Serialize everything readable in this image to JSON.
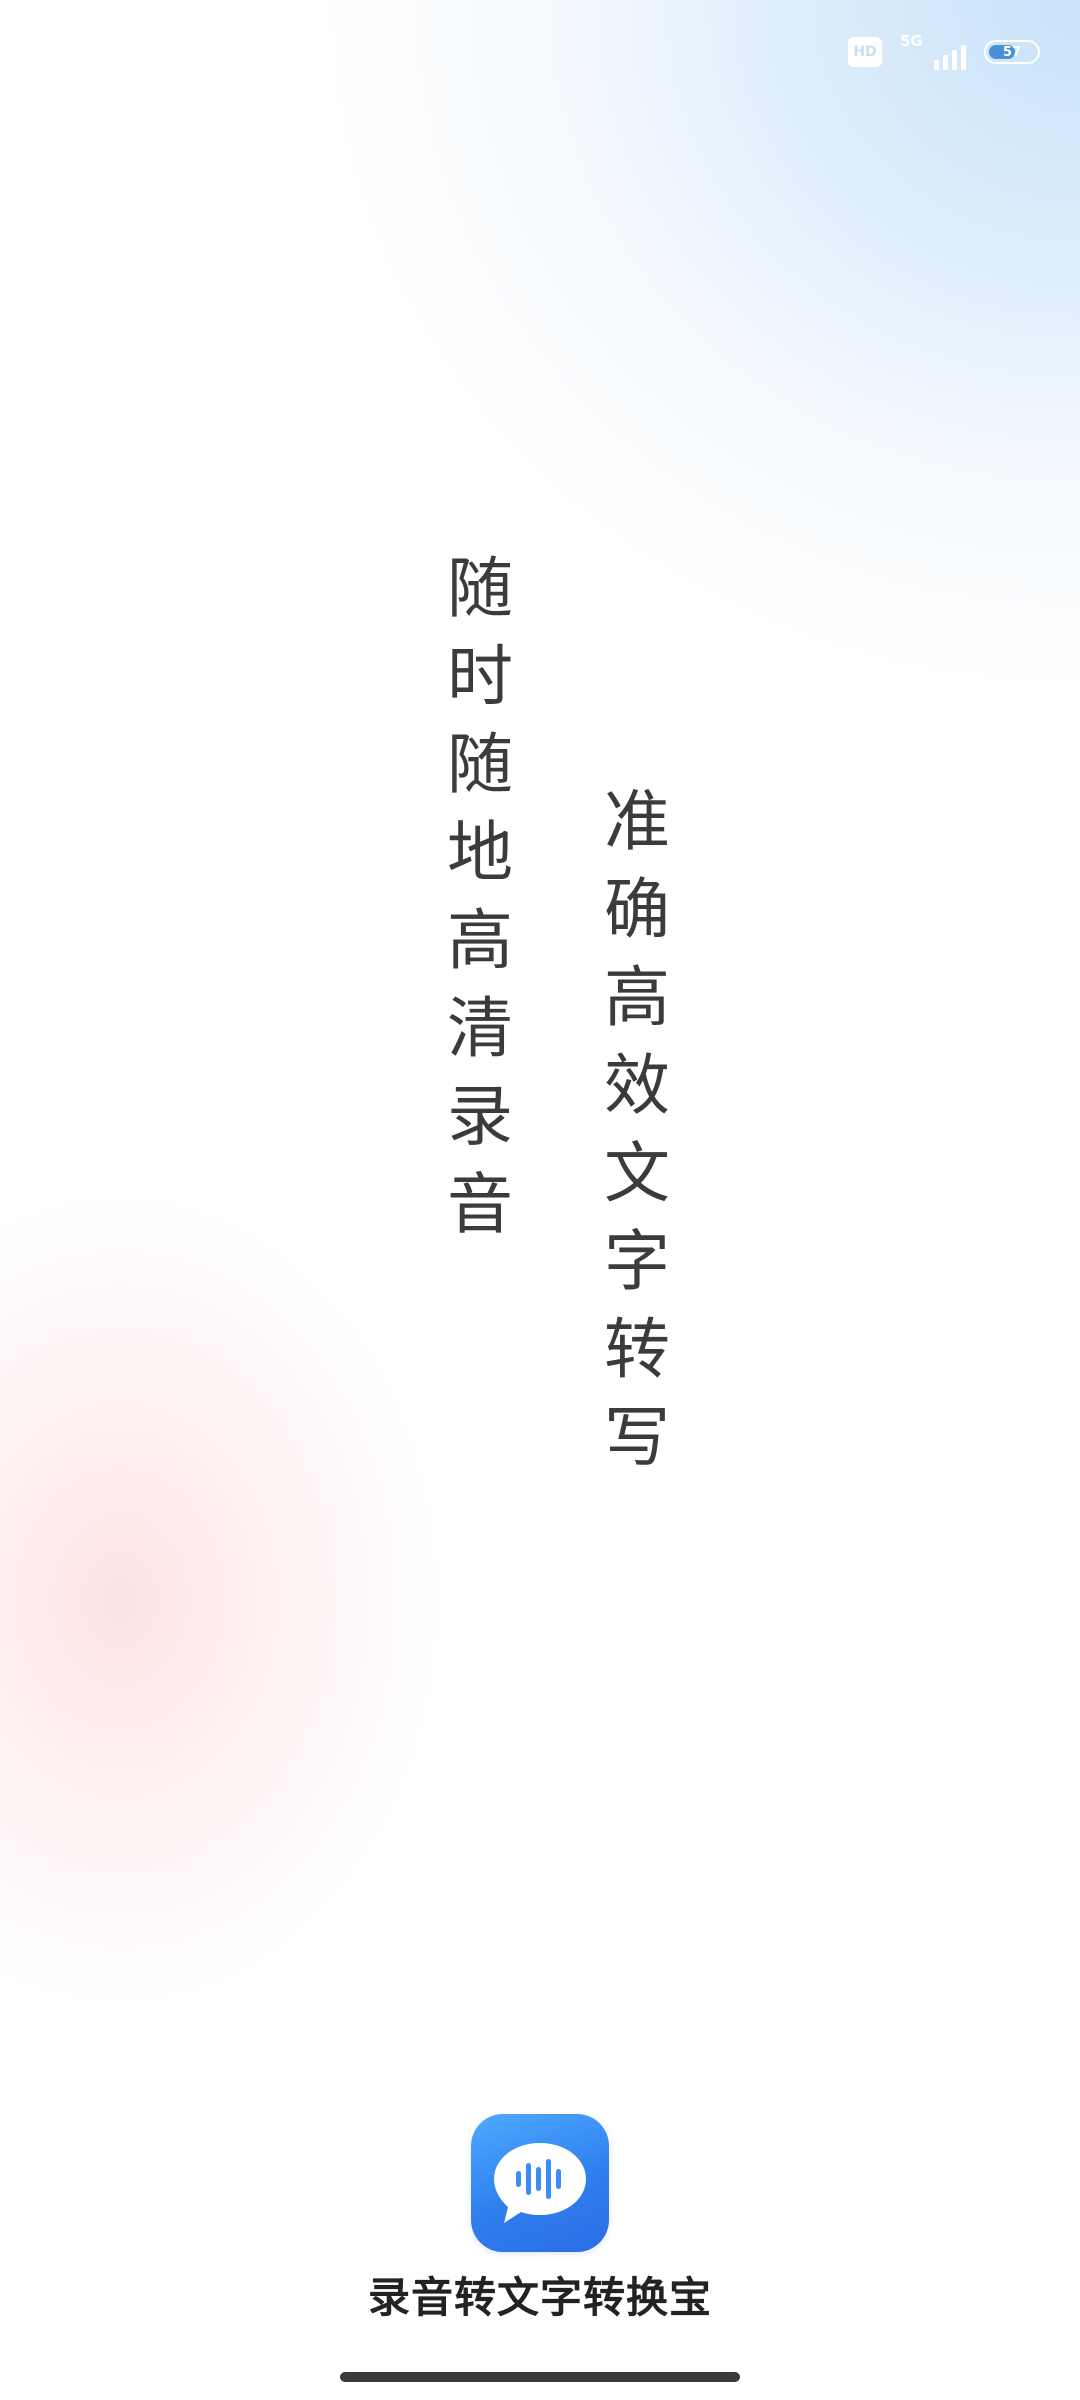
{
  "status_bar": {
    "hd_label": "HD",
    "network_label": "5G",
    "battery_level": "57",
    "battery_fraction": 0.57,
    "signal_bars": 4
  },
  "slogans": {
    "left": [
      "随",
      "时",
      "随",
      "地",
      "高",
      "清",
      "录",
      "音"
    ],
    "right": [
      "准",
      "确",
      "高",
      "效",
      "文",
      "字",
      "转",
      "写"
    ]
  },
  "app": {
    "name": "录音转文字转换宝",
    "icon": "voice-chat-bubble-icon",
    "brand_color": "#2f7fee"
  },
  "colors": {
    "text": "#3b3b3b",
    "bg_top_tint": "#c5e0f8",
    "bg_side_tint": "#fcdede"
  }
}
